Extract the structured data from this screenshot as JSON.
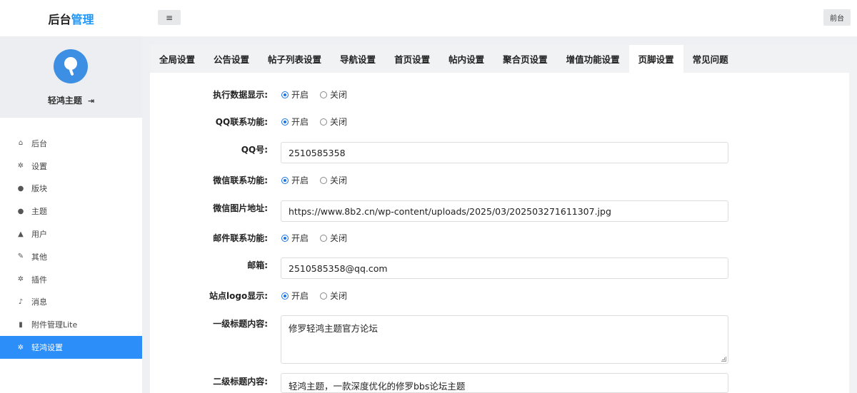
{
  "header": {
    "brand_prefix": "后台",
    "brand_accent": "管理",
    "menu_toggle": "≡",
    "front_button": "前台"
  },
  "profile": {
    "name": "轻鸿主题",
    "logout_icon": "⇥"
  },
  "sidebar": {
    "items": [
      {
        "label": "后台",
        "icon": "home-icon",
        "glyph": "⌂"
      },
      {
        "label": "设置",
        "icon": "gear-icon",
        "glyph": "✲"
      },
      {
        "label": "版块",
        "icon": "comment-icon",
        "glyph": "●"
      },
      {
        "label": "主题",
        "icon": "comment-icon",
        "glyph": "●"
      },
      {
        "label": "用户",
        "icon": "user-icon",
        "glyph": "▲"
      },
      {
        "label": "其他",
        "icon": "wrench-icon",
        "glyph": "✎"
      },
      {
        "label": "插件",
        "icon": "cogs-icon",
        "glyph": "✲"
      },
      {
        "label": "消息",
        "icon": "bell-icon",
        "glyph": "♪"
      },
      {
        "label": "附件管理Lite",
        "icon": "file-icon",
        "glyph": "▮"
      },
      {
        "label": "轻鸿设置",
        "icon": "gear-icon",
        "glyph": "✲"
      }
    ],
    "active_index": 9
  },
  "tabs": {
    "items": [
      "全局设置",
      "公告设置",
      "帖子列表设置",
      "导航设置",
      "首页设置",
      "帖内设置",
      "聚合页设置",
      "增值功能设置",
      "页脚设置",
      "常见问题"
    ],
    "active_index": 8
  },
  "form": {
    "radio_on_label": "开启",
    "radio_off_label": "关闭",
    "exec_data_label": "执行数据显示:",
    "qq_contact_label": "QQ联系功能:",
    "qq_number_label": "QQ号:",
    "qq_number_value": "2510585358",
    "wechat_contact_label": "微信联系功能:",
    "wechat_image_label": "微信图片地址:",
    "wechat_image_value": "https://www.8b2.cn/wp-content/uploads/2025/03/202503271611307.jpg",
    "mail_contact_label": "邮件联系功能:",
    "mail_label": "邮箱:",
    "mail_value": "2510585358@qq.com",
    "site_logo_label": "站点logo显示:",
    "primary_title_label": "一级标题内容:",
    "primary_title_value": "修罗轻鸿主题官方论坛",
    "secondary_title_label": "二级标题内容:",
    "secondary_title_value": "轻鸿主题，一款深度优化的修罗bbs论坛主题"
  }
}
